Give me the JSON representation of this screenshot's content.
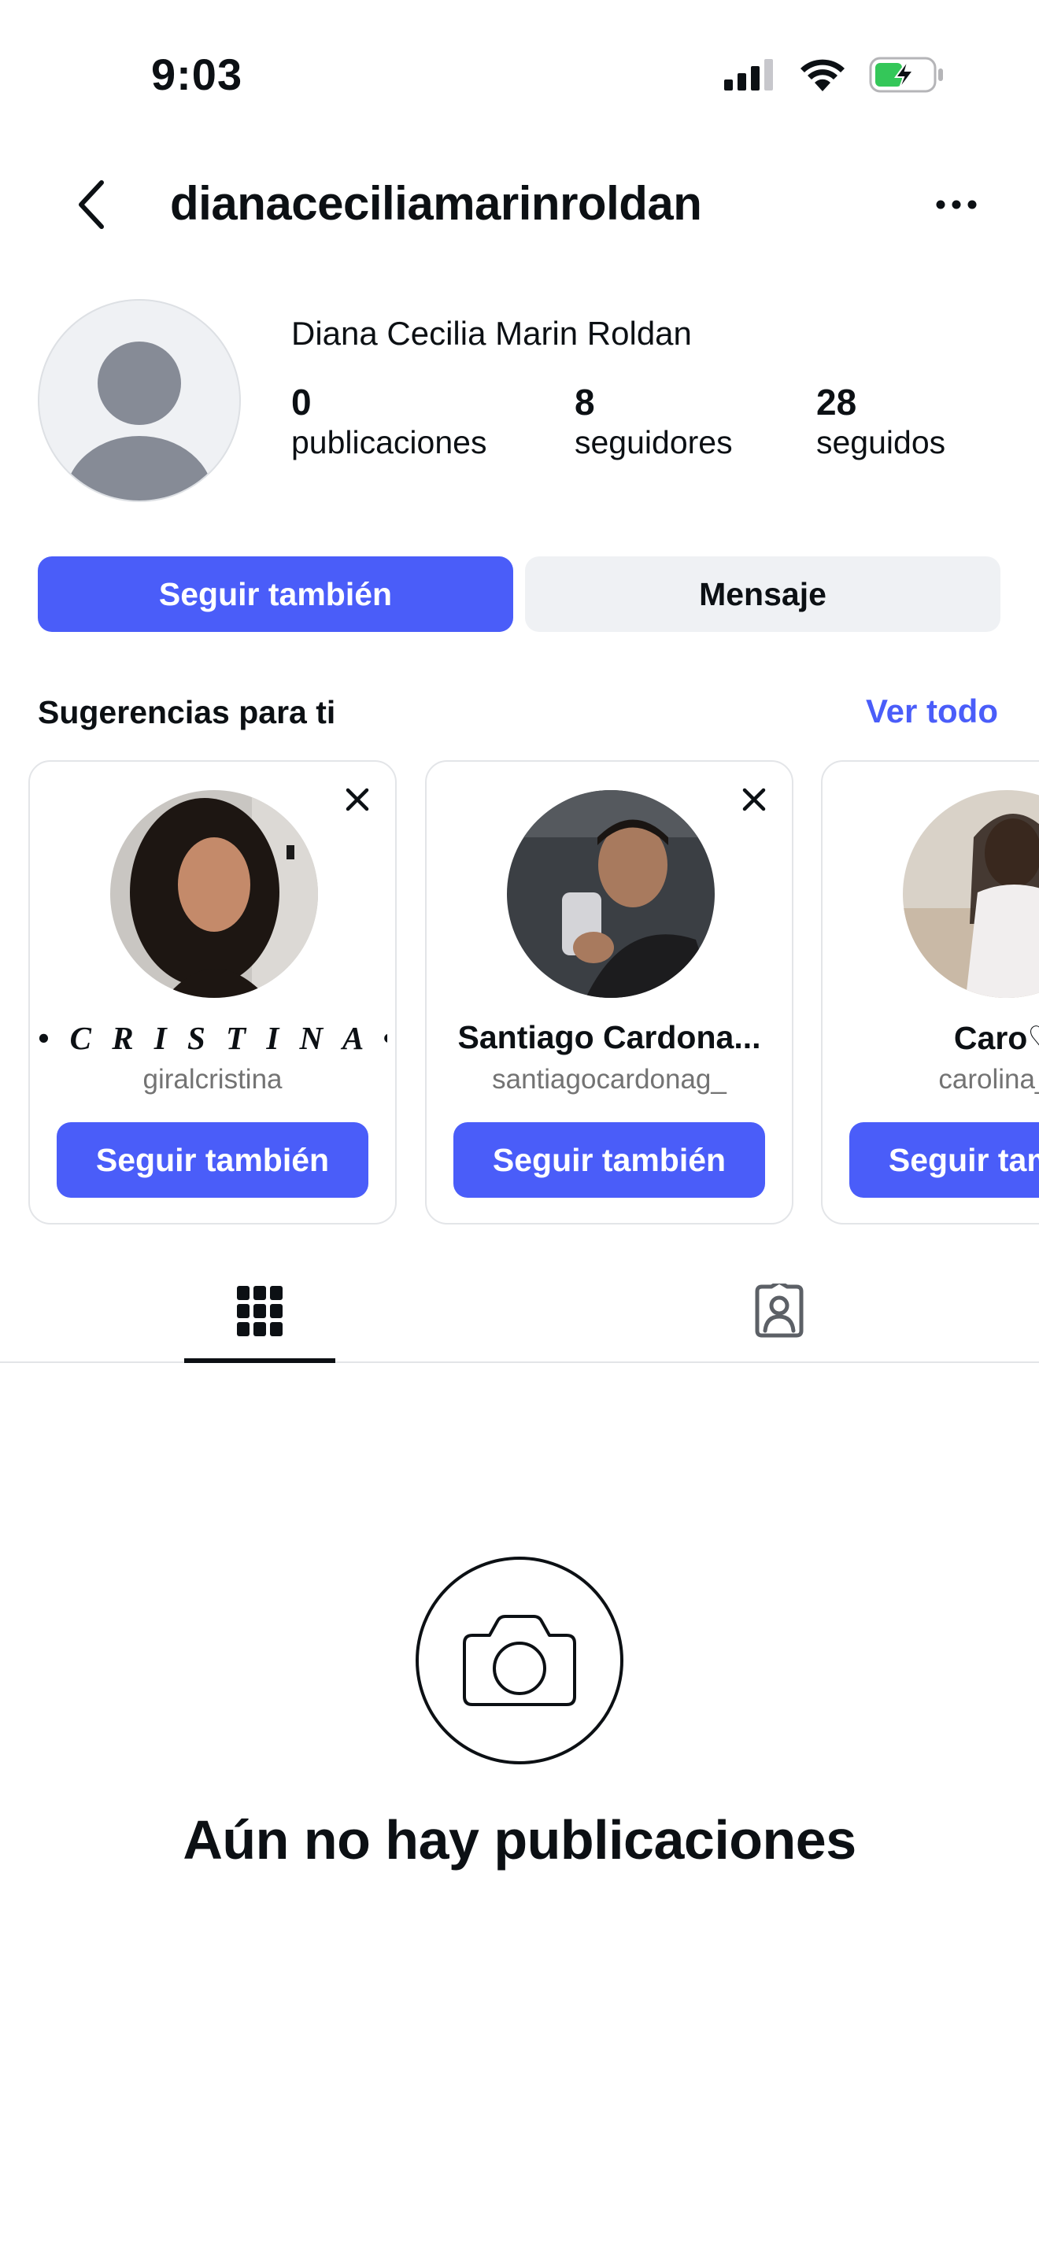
{
  "status_bar": {
    "time": "9:03"
  },
  "header": {
    "username": "dianaceciliamarinroldan"
  },
  "profile": {
    "full_name": "Diana Cecilia Marin Roldan",
    "stats": [
      {
        "value": "0",
        "label": "publicaciones"
      },
      {
        "value": "8",
        "label": "seguidores"
      },
      {
        "value": "28",
        "label": "seguidos"
      }
    ]
  },
  "actions": {
    "follow_label": "Seguir también",
    "message_label": "Mensaje"
  },
  "suggestions": {
    "title": "Sugerencias para ti",
    "see_all": "Ver todo",
    "cards": [
      {
        "name": "• C R I S T I N A •",
        "handle": "giralcristina",
        "button": "Seguir también"
      },
      {
        "name": "Santiago Cardona...",
        "handle": "santiagocardonag_",
        "button": "Seguir también"
      },
      {
        "name": "Caro♡",
        "handle": "carolina_jo",
        "button": "Seguir también"
      }
    ]
  },
  "tabs": [
    {
      "icon": "grid-icon",
      "active": true
    },
    {
      "icon": "tagged-icon",
      "active": false
    }
  ],
  "empty_state": {
    "icon": "camera-icon",
    "text": "Aún no hay publicaciones"
  },
  "colors": {
    "accent": "#4a5df9",
    "secondary_button": "#eff1f4",
    "text": "#0c1014",
    "muted": "#737373"
  }
}
